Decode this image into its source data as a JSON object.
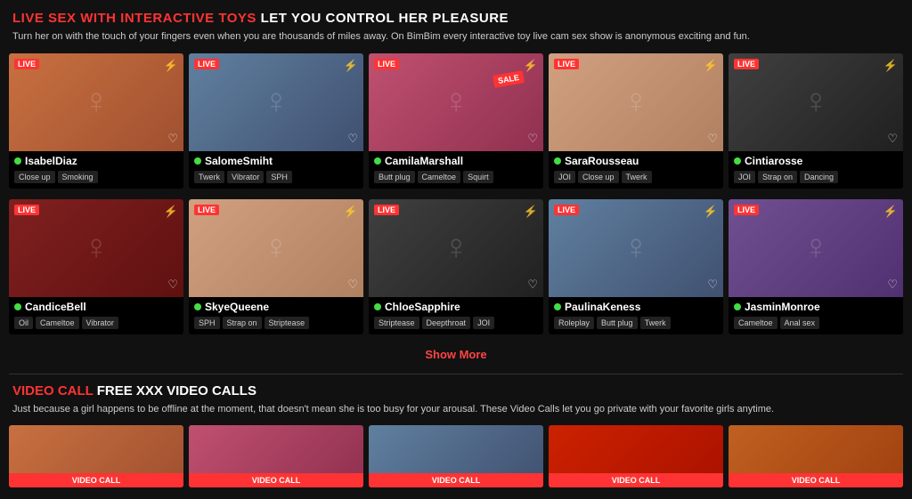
{
  "hero": {
    "title_highlight": "LIVE SEX WITH INTERACTIVE TOYS",
    "title_rest": " LET YOU CONTROL HER PLEASURE",
    "description": "Turn her on with the touch of your fingers even when you are thousands of miles away. On BimBim every interactive toy live cam sex show is anonymous exciting and fun."
  },
  "models_row1": [
    {
      "name": "IsabelDiaz",
      "tags": [
        "Close up",
        "Smoking"
      ],
      "live": true,
      "bg": "bg-warm"
    },
    {
      "name": "SalomeSmiht",
      "tags": [
        "Twerk",
        "Vibrator",
        "SPH"
      ],
      "live": true,
      "bg": "bg-cool"
    },
    {
      "name": "CamilaMarshall",
      "tags": [
        "Butt plug",
        "Cameltoe",
        "Squirt"
      ],
      "live": true,
      "sale": true,
      "bg": "bg-pink"
    },
    {
      "name": "SaraRousseau",
      "tags": [
        "JOI",
        "Close up",
        "Twerk"
      ],
      "live": true,
      "bg": "bg-light"
    },
    {
      "name": "Cintiarosse",
      "tags": [
        "JOI",
        "Strap on",
        "Dancing"
      ],
      "live": true,
      "bg": "bg-dark"
    }
  ],
  "models_row2": [
    {
      "name": "CandiceBell",
      "tags": [
        "Oil",
        "Cameltoe",
        "Vibrator"
      ],
      "live": true,
      "bg": "bg-red"
    },
    {
      "name": "SkyeQueene",
      "tags": [
        "SPH",
        "Strap on",
        "Striptease"
      ],
      "live": true,
      "bg": "bg-light"
    },
    {
      "name": "ChloeSapphire",
      "tags": [
        "Striptease",
        "Deepthroat",
        "JOI"
      ],
      "live": true,
      "bg": "bg-dark"
    },
    {
      "name": "PaulinaKeness",
      "tags": [
        "Roleplay",
        "Butt plug",
        "Twerk"
      ],
      "live": true,
      "bg": "bg-cool"
    },
    {
      "name": "JasminMonroe",
      "tags": [
        "Cameltoe",
        "Anal sex"
      ],
      "live": true,
      "bg": "bg-purple"
    }
  ],
  "show_more_label": "Show More",
  "video_call_section": {
    "title_highlight": "VIDEO CALL",
    "title_rest": " FREE XXX VIDEO CALLS",
    "description": "Just because a girl happens to be offline at the moment, that doesn't mean she is too busy for your arousal. These Video Calls let you go private with your favorite girls anytime.",
    "badge_label": "VIDEO CALL"
  },
  "video_call_cards": [
    {
      "bg": "bg-warm"
    },
    {
      "bg": "bg-pink"
    },
    {
      "bg": "bg-cool"
    },
    {
      "bg": "bg-christmas"
    },
    {
      "bg": "bg-orange"
    }
  ]
}
